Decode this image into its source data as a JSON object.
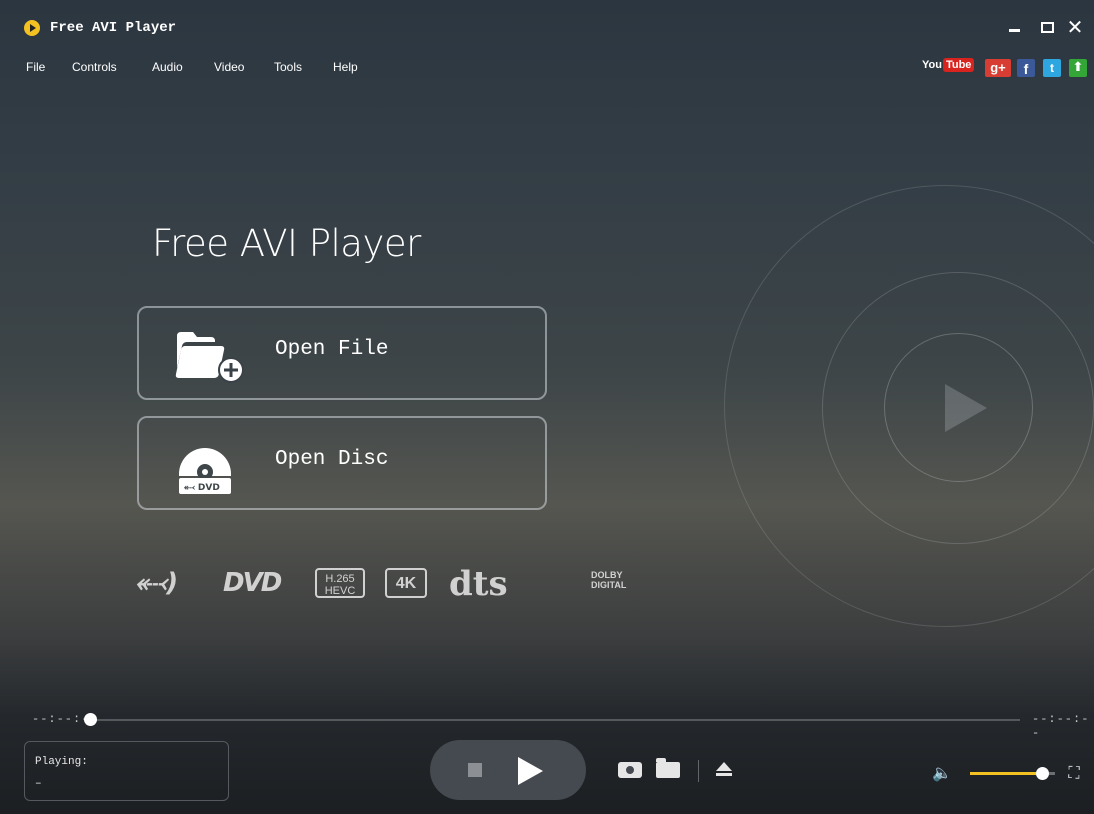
{
  "window": {
    "title": "Free AVI Player",
    "close_glyph": "✕"
  },
  "menu": {
    "items": [
      "File",
      "Controls",
      "Audio",
      "Video",
      "Tools",
      "Help"
    ]
  },
  "social": {
    "youtube_you": "You",
    "youtube_tube": "Tube",
    "googleplus": "g+",
    "facebook": "f",
    "twitter": "t",
    "upload": "⬆"
  },
  "main": {
    "title": "Free AVI Player",
    "open_file_label": "Open File",
    "open_disc_label": "Open Disc"
  },
  "formats": {
    "bluray": "⬷)",
    "dvd": "DVD",
    "h265": "H.265 HEVC",
    "uhd4k": "4K",
    "dts": "dts",
    "dolby": "DOLBY DIGITAL"
  },
  "playback": {
    "time_elapsed": "--:--:--",
    "time_total": "--:--:--",
    "status_label": "Playing:",
    "status_value": "–",
    "volume_level": 0.85
  },
  "icons": {
    "volume": "🔈",
    "fullscreen": "⛶"
  },
  "colors": {
    "accent": "#f3c122"
  }
}
